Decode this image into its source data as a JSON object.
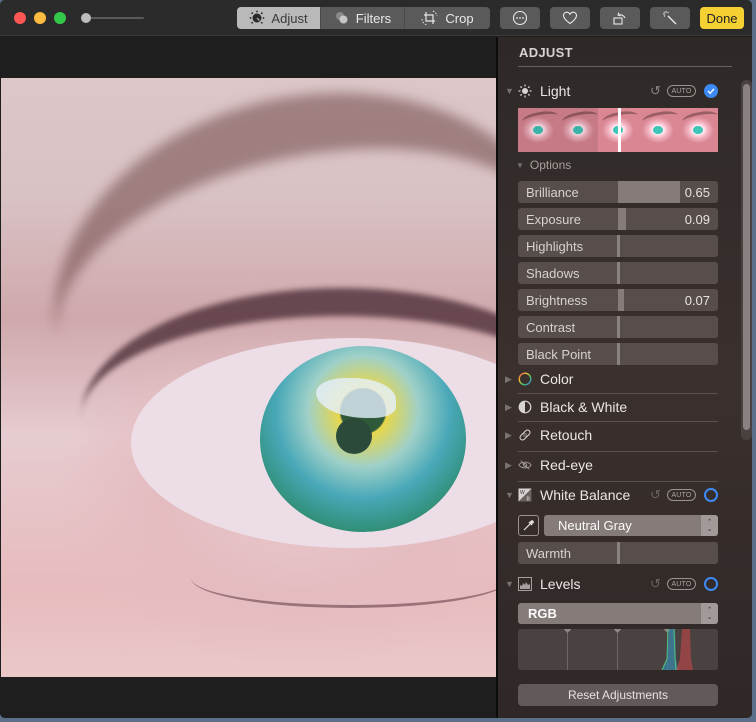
{
  "window": {
    "traffic_lights": [
      "close",
      "minimize",
      "zoom"
    ],
    "zoom_slider": {
      "value_fraction": 0.0
    }
  },
  "toolbar": {
    "segments": [
      {
        "label": "Adjust",
        "icon": "adjust-dial-icon",
        "active": true
      },
      {
        "label": "Filters",
        "icon": "filters-circles-icon",
        "active": false
      },
      {
        "label": "Crop",
        "icon": "crop-icon",
        "active": false
      }
    ],
    "buttons": [
      {
        "name": "more-options",
        "icon": "ellipsis-circle-icon"
      },
      {
        "name": "favorite",
        "icon": "heart-icon"
      },
      {
        "name": "rotate",
        "icon": "rotate-icon"
      },
      {
        "name": "auto-enhance",
        "icon": "magic-wand-icon"
      }
    ],
    "done_label": "Done"
  },
  "panel": {
    "title": "ADJUST",
    "light": {
      "label": "Light",
      "icon": "sun-icon",
      "auto_label": "AUTO",
      "enabled": true,
      "expanded": true,
      "filmstrip_marker_fraction": 0.51,
      "options_label": "Options",
      "sliders": [
        {
          "label": "Brilliance",
          "value": "0.65"
        },
        {
          "label": "Exposure",
          "value": "0.09"
        },
        {
          "label": "Highlights",
          "value": ""
        },
        {
          "label": "Shadows",
          "value": ""
        },
        {
          "label": "Brightness",
          "value": "0.07"
        },
        {
          "label": "Contrast",
          "value": ""
        },
        {
          "label": "Black Point",
          "value": ""
        }
      ]
    },
    "sections": [
      {
        "label": "Color",
        "icon": "color-wheel-icon",
        "expanded": false
      },
      {
        "label": "Black & White",
        "icon": "half-circle-icon",
        "expanded": false
      },
      {
        "label": "Retouch",
        "icon": "bandage-icon",
        "expanded": false
      },
      {
        "label": "Red-eye",
        "icon": "eye-slash-icon",
        "expanded": false
      }
    ],
    "white_balance": {
      "label": "White Balance",
      "icon": "white-balance-icon",
      "auto_label": "AUTO",
      "enabled": false,
      "expanded": true,
      "mode_selected": "Neutral Gray",
      "warmth_label": "Warmth",
      "warmth_value": ""
    },
    "levels": {
      "label": "Levels",
      "icon": "histogram-icon",
      "auto_label": "AUTO",
      "enabled": false,
      "expanded": true,
      "channel_selected": "RGB"
    },
    "reset_label": "Reset Adjustments"
  },
  "colors": {
    "accent_blue": "#3d8af5",
    "done_yellow": "#f5d033",
    "hist_green": "#4fbf7a",
    "hist_red": "#d04848",
    "hist_blue": "#3a7fa0"
  }
}
